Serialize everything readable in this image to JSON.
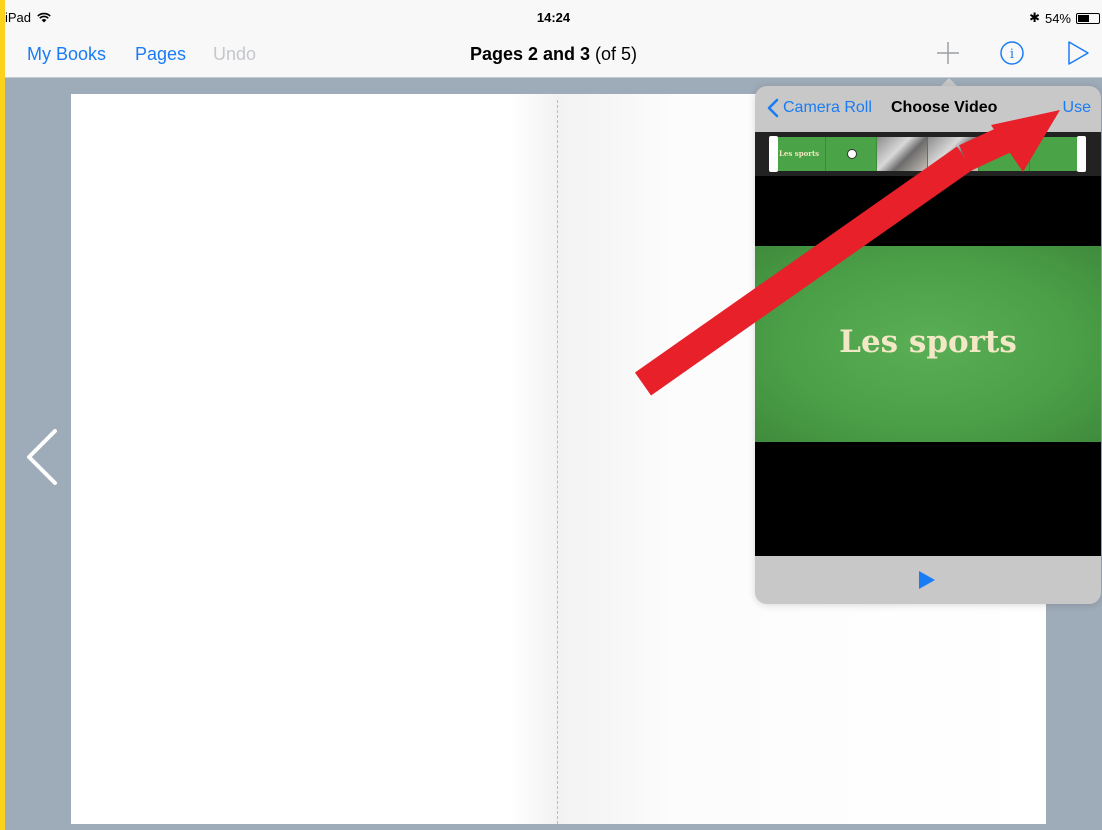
{
  "status": {
    "device": "iPad",
    "time": "14:24",
    "battery": "54%",
    "battery_level": 0.54
  },
  "nav": {
    "my_books": "My Books",
    "pages": "Pages",
    "undo": "Undo",
    "title_bold": "Pages 2 and 3",
    "title_rest": " (of 5)",
    "icons": [
      "plus-icon",
      "info-icon",
      "play-icon"
    ]
  },
  "popover": {
    "back_label": "Camera Roll",
    "title": "Choose Video",
    "use_label": "Use",
    "film_label": "Les sports",
    "slide_title": "Les sports"
  },
  "colors": {
    "accent": "#1a7cf5",
    "frame_border": "#fcd21c",
    "annotation_arrow": "#e8202a",
    "slide_green": "#4b9f47"
  }
}
